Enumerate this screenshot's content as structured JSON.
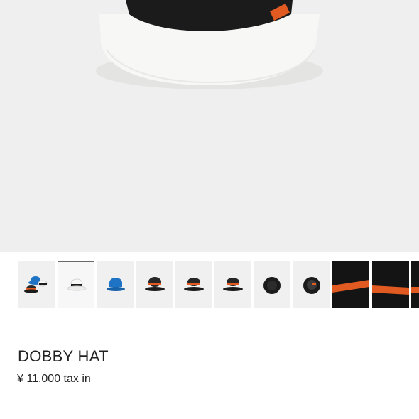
{
  "product": {
    "name": "DOBBY HAT",
    "price": "¥ 11,000 tax in"
  },
  "thumbnails": [
    {
      "label": "multi-color-hats",
      "selected": false
    },
    {
      "label": "white-hat",
      "selected": true
    },
    {
      "label": "blue-hat",
      "selected": false
    },
    {
      "label": "black-hat-front",
      "selected": false
    },
    {
      "label": "black-hat-side",
      "selected": false
    },
    {
      "label": "black-hat-back",
      "selected": false
    },
    {
      "label": "black-hat-top",
      "selected": false
    },
    {
      "label": "black-hat-inside",
      "selected": false
    },
    {
      "label": "orange-band-detail-1",
      "selected": false
    },
    {
      "label": "orange-band-detail-2",
      "selected": false
    },
    {
      "label": "orange-band-detail-3",
      "selected": false
    }
  ],
  "colors": {
    "hero_background": "#efefef",
    "hat_white": "#f6f6f4",
    "band_black": "#1b1b1b",
    "tag_orange": "#e05a22",
    "hat_blue": "#1e73c4"
  }
}
